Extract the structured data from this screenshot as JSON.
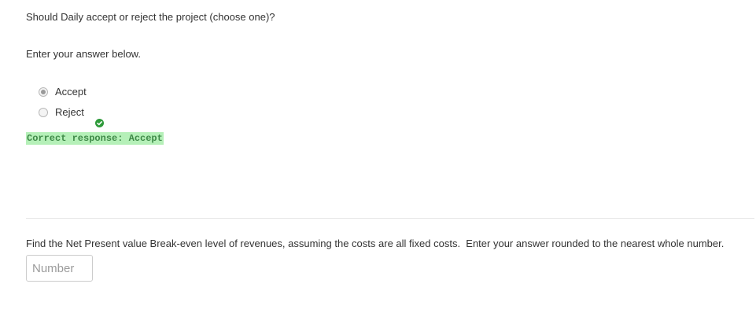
{
  "question1": {
    "prompt": "Should Daily accept or reject the project (choose one)?",
    "instruction": "Enter your answer below.",
    "options": [
      {
        "label": "Accept",
        "selected": true
      },
      {
        "label": "Reject",
        "selected": false
      }
    ],
    "status_icon": "check-circle-icon",
    "feedback": "Correct response: Accept",
    "colors": {
      "feedback_bg": "#b5f0b8",
      "feedback_text": "#3f8a48",
      "check": "#2e9a3a"
    }
  },
  "question2": {
    "prompt": "Find the Net Present value Break-even level of revenues, assuming the costs are all fixed costs.  Enter your answer rounded to the nearest whole number.",
    "input": {
      "placeholder": "Number",
      "value": ""
    }
  }
}
